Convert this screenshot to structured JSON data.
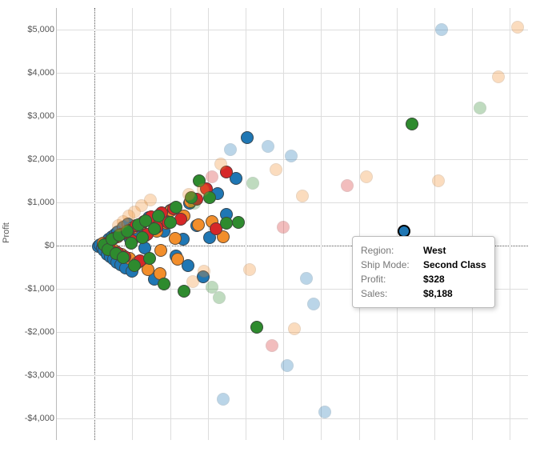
{
  "chart_data": {
    "type": "scatter",
    "ylabel": "Profit",
    "xlabel": "",
    "ylim": [
      -4500,
      5500
    ],
    "xlim": [
      -1000,
      11500
    ],
    "yticks": [
      {
        "v": 5000,
        "label": "$5,000"
      },
      {
        "v": 4000,
        "label": "$4,000"
      },
      {
        "v": 3000,
        "label": "$3,000"
      },
      {
        "v": 2000,
        "label": "$2,000"
      },
      {
        "v": 1000,
        "label": "$1,000"
      },
      {
        "v": 0,
        "label": "$0"
      },
      {
        "v": -1000,
        "label": "-$1,000"
      },
      {
        "v": -2000,
        "label": "-$2,000"
      },
      {
        "v": -3000,
        "label": "-$3,000"
      },
      {
        "v": -4000,
        "label": "-$4,000"
      }
    ],
    "x_gridlines": [
      0,
      1000,
      2000,
      3000,
      4000,
      5000,
      6000,
      7000,
      8000,
      9000,
      10000,
      11000
    ],
    "series_colors": {
      "Central": "#2e8b2e",
      "East": "#f28e2b",
      "South": "#d62728",
      "West": "#1f77b4"
    },
    "points": [
      {
        "sales": 8188,
        "profit": 328,
        "region": "West",
        "ship_mode": "Second Class",
        "highlight": true
      },
      {
        "sales": 100,
        "profit": -20,
        "region": "West",
        "faded": false
      },
      {
        "sales": 150,
        "profit": 10,
        "region": "West",
        "faded": false
      },
      {
        "sales": 200,
        "profit": -60,
        "region": "West",
        "faded": false
      },
      {
        "sales": 220,
        "profit": 40,
        "region": "West",
        "faded": false
      },
      {
        "sales": 260,
        "profit": -120,
        "region": "West",
        "faded": false
      },
      {
        "sales": 300,
        "profit": 80,
        "region": "West",
        "faded": false
      },
      {
        "sales": 340,
        "profit": -200,
        "region": "West",
        "faded": false
      },
      {
        "sales": 380,
        "profit": 140,
        "region": "West",
        "faded": false
      },
      {
        "sales": 420,
        "profit": -260,
        "region": "West",
        "faded": false
      },
      {
        "sales": 460,
        "profit": 200,
        "region": "West",
        "faded": false
      },
      {
        "sales": 500,
        "profit": -320,
        "region": "West",
        "faded": false
      },
      {
        "sales": 540,
        "profit": 260,
        "region": "West",
        "faded": false
      },
      {
        "sales": 580,
        "profit": -380,
        "region": "West",
        "faded": false
      },
      {
        "sales": 620,
        "profit": 320,
        "region": "West",
        "faded": false
      },
      {
        "sales": 700,
        "profit": -440,
        "region": "West",
        "faded": false
      },
      {
        "sales": 760,
        "profit": 420,
        "region": "West",
        "faded": false
      },
      {
        "sales": 820,
        "profit": -520,
        "region": "West",
        "faded": false
      },
      {
        "sales": 880,
        "profit": 500,
        "region": "West",
        "faded": false
      },
      {
        "sales": 940,
        "profit": 140,
        "region": "West",
        "faded": false
      },
      {
        "sales": 1000,
        "profit": -600,
        "region": "West",
        "faded": false
      },
      {
        "sales": 1060,
        "profit": 280,
        "region": "West",
        "faded": false
      },
      {
        "sales": 1140,
        "profit": -380,
        "region": "West",
        "faded": false
      },
      {
        "sales": 1220,
        "profit": 460,
        "region": "West",
        "faded": false
      },
      {
        "sales": 1320,
        "profit": -60,
        "region": "West",
        "faded": false
      },
      {
        "sales": 1440,
        "profit": 640,
        "region": "West",
        "faded": false
      },
      {
        "sales": 1580,
        "profit": -780,
        "region": "West",
        "faded": false
      },
      {
        "sales": 1720,
        "profit": 700,
        "region": "West",
        "faded": false
      },
      {
        "sales": 1840,
        "profit": 340,
        "region": "West",
        "faded": false
      },
      {
        "sales": 2000,
        "profit": 820,
        "region": "West",
        "faded": false
      },
      {
        "sales": 2160,
        "profit": -240,
        "region": "West",
        "faded": false
      },
      {
        "sales": 2340,
        "profit": 140,
        "region": "West",
        "faded": false
      },
      {
        "sales": 2520,
        "profit": 980,
        "region": "West",
        "faded": false
      },
      {
        "sales": 2700,
        "profit": 460,
        "region": "West",
        "faded": false
      },
      {
        "sales": 2480,
        "profit": -460,
        "region": "West",
        "faded": false
      },
      {
        "sales": 3040,
        "profit": 180,
        "region": "West",
        "faded": false
      },
      {
        "sales": 3260,
        "profit": 1200,
        "region": "West",
        "faded": false
      },
      {
        "sales": 3500,
        "profit": 720,
        "region": "West",
        "faded": false
      },
      {
        "sales": 3740,
        "profit": 1560,
        "region": "West",
        "faded": false
      },
      {
        "sales": 4040,
        "profit": 2500,
        "region": "West",
        "faded": false
      },
      {
        "sales": 2880,
        "profit": -720,
        "region": "West",
        "faded": false
      },
      {
        "sales": 220,
        "profit": 60,
        "region": "East",
        "faded": false
      },
      {
        "sales": 320,
        "profit": -40,
        "region": "East",
        "faded": false
      },
      {
        "sales": 420,
        "profit": 120,
        "region": "East",
        "faded": false
      },
      {
        "sales": 520,
        "profit": -120,
        "region": "East",
        "faded": false
      },
      {
        "sales": 620,
        "profit": 200,
        "region": "East",
        "faded": false
      },
      {
        "sales": 720,
        "profit": -200,
        "region": "East",
        "faded": false
      },
      {
        "sales": 820,
        "profit": 300,
        "region": "East",
        "faded": false
      },
      {
        "sales": 920,
        "profit": -300,
        "region": "East",
        "faded": false
      },
      {
        "sales": 1020,
        "profit": 400,
        "region": "East",
        "faded": false
      },
      {
        "sales": 1120,
        "profit": -400,
        "region": "East",
        "faded": false
      },
      {
        "sales": 1220,
        "profit": 500,
        "region": "East",
        "faded": false
      },
      {
        "sales": 1320,
        "profit": 220,
        "region": "East",
        "faded": false
      },
      {
        "sales": 1420,
        "profit": -560,
        "region": "East",
        "faded": false
      },
      {
        "sales": 1520,
        "profit": 620,
        "region": "East",
        "faded": false
      },
      {
        "sales": 1640,
        "profit": 340,
        "region": "East",
        "faded": false
      },
      {
        "sales": 1760,
        "profit": -120,
        "region": "East",
        "faded": false
      },
      {
        "sales": 1900,
        "profit": 520,
        "region": "East",
        "faded": false
      },
      {
        "sales": 2040,
        "profit": 820,
        "region": "East",
        "faded": false
      },
      {
        "sales": 2200,
        "profit": -320,
        "region": "East",
        "faded": false
      },
      {
        "sales": 2360,
        "profit": 680,
        "region": "East",
        "faded": false
      },
      {
        "sales": 2540,
        "profit": 1020,
        "region": "East",
        "faded": false
      },
      {
        "sales": 2740,
        "profit": 480,
        "region": "East",
        "faded": false
      },
      {
        "sales": 2140,
        "profit": 160,
        "region": "East",
        "faded": false
      },
      {
        "sales": 3100,
        "profit": 560,
        "region": "East",
        "faded": false
      },
      {
        "sales": 1740,
        "profit": -640,
        "region": "East",
        "faded": false
      },
      {
        "sales": 3400,
        "profit": 200,
        "region": "East",
        "faded": false
      },
      {
        "sales": 300,
        "profit": 40,
        "region": "South",
        "faded": false
      },
      {
        "sales": 400,
        "profit": -80,
        "region": "South",
        "faded": false
      },
      {
        "sales": 500,
        "profit": 160,
        "region": "South",
        "faded": false
      },
      {
        "sales": 600,
        "profit": -160,
        "region": "South",
        "faded": false
      },
      {
        "sales": 700,
        "profit": 260,
        "region": "South",
        "faded": false
      },
      {
        "sales": 800,
        "profit": -260,
        "region": "South",
        "faded": false
      },
      {
        "sales": 900,
        "profit": 360,
        "region": "South",
        "faded": false
      },
      {
        "sales": 1000,
        "profit": 120,
        "region": "South",
        "faded": false
      },
      {
        "sales": 1100,
        "profit": 460,
        "region": "South",
        "faded": false
      },
      {
        "sales": 1200,
        "profit": -360,
        "region": "South",
        "faded": false
      },
      {
        "sales": 1300,
        "profit": 560,
        "region": "South",
        "faded": false
      },
      {
        "sales": 1400,
        "profit": 260,
        "region": "South",
        "faded": false
      },
      {
        "sales": 1500,
        "profit": 660,
        "region": "South",
        "faded": false
      },
      {
        "sales": 1640,
        "profit": 420,
        "region": "South",
        "faded": false
      },
      {
        "sales": 1780,
        "profit": 760,
        "region": "South",
        "faded": false
      },
      {
        "sales": 1940,
        "profit": 540,
        "region": "South",
        "faded": false
      },
      {
        "sales": 2100,
        "profit": 860,
        "region": "South",
        "faded": false
      },
      {
        "sales": 2280,
        "profit": 620,
        "region": "South",
        "faded": false
      },
      {
        "sales": 2700,
        "profit": 1080,
        "region": "South",
        "faded": false
      },
      {
        "sales": 2960,
        "profit": 1320,
        "region": "South",
        "faded": false
      },
      {
        "sales": 3500,
        "profit": 1700,
        "region": "South",
        "faded": false
      },
      {
        "sales": 3220,
        "profit": 380,
        "region": "South",
        "faded": false
      },
      {
        "sales": 260,
        "profit": 20,
        "region": "Central",
        "faded": false
      },
      {
        "sales": 360,
        "profit": -100,
        "region": "Central",
        "faded": false
      },
      {
        "sales": 460,
        "profit": 140,
        "region": "Central",
        "faded": false
      },
      {
        "sales": 560,
        "profit": -180,
        "region": "Central",
        "faded": false
      },
      {
        "sales": 660,
        "profit": 240,
        "region": "Central",
        "faded": false
      },
      {
        "sales": 760,
        "profit": -280,
        "region": "Central",
        "faded": false
      },
      {
        "sales": 860,
        "profit": 340,
        "region": "Central",
        "faded": false
      },
      {
        "sales": 960,
        "profit": 60,
        "region": "Central",
        "faded": false
      },
      {
        "sales": 1060,
        "profit": -460,
        "region": "Central",
        "faded": false
      },
      {
        "sales": 1160,
        "profit": 480,
        "region": "Central",
        "faded": false
      },
      {
        "sales": 1260,
        "profit": 180,
        "region": "Central",
        "faded": false
      },
      {
        "sales": 1360,
        "profit": 580,
        "region": "Central",
        "faded": false
      },
      {
        "sales": 1460,
        "profit": -300,
        "region": "Central",
        "faded": false
      },
      {
        "sales": 1580,
        "profit": 380,
        "region": "Central",
        "faded": false
      },
      {
        "sales": 1700,
        "profit": 680,
        "region": "Central",
        "faded": false
      },
      {
        "sales": 1840,
        "profit": -880,
        "region": "Central",
        "faded": false
      },
      {
        "sales": 2000,
        "profit": 540,
        "region": "Central",
        "faded": false
      },
      {
        "sales": 2160,
        "profit": 880,
        "region": "Central",
        "faded": false
      },
      {
        "sales": 2360,
        "profit": -1060,
        "region": "Central",
        "faded": false
      },
      {
        "sales": 2560,
        "profit": 1120,
        "region": "Central",
        "faded": false
      },
      {
        "sales": 2780,
        "profit": 1500,
        "region": "Central",
        "faded": false
      },
      {
        "sales": 3040,
        "profit": 1120,
        "region": "Central",
        "faded": false
      },
      {
        "sales": 3800,
        "profit": 540,
        "region": "Central",
        "faded": false
      },
      {
        "sales": 3500,
        "profit": 520,
        "region": "Central",
        "faded": false
      },
      {
        "sales": 4300,
        "profit": -1880,
        "region": "Central",
        "faded": false
      },
      {
        "sales": 8400,
        "profit": 2820,
        "region": "Central",
        "faded": false
      },
      {
        "sales": 9200,
        "profit": 5000,
        "region": "West",
        "faded": true
      },
      {
        "sales": 11200,
        "profit": 5050,
        "region": "East",
        "faded": true
      },
      {
        "sales": 10700,
        "profit": 3900,
        "region": "East",
        "faded": true
      },
      {
        "sales": 10200,
        "profit": 3180,
        "region": "Central",
        "faded": true
      },
      {
        "sales": 9100,
        "profit": 1500,
        "region": "East",
        "faded": true
      },
      {
        "sales": 7200,
        "profit": 1600,
        "region": "East",
        "faded": true
      },
      {
        "sales": 6700,
        "profit": 1380,
        "region": "South",
        "faded": true
      },
      {
        "sales": 5500,
        "profit": 1140,
        "region": "East",
        "faded": true
      },
      {
        "sales": 5000,
        "profit": 420,
        "region": "South",
        "faded": true
      },
      {
        "sales": 4800,
        "profit": 1760,
        "region": "East",
        "faded": true
      },
      {
        "sales": 5200,
        "profit": 2080,
        "region": "West",
        "faded": true
      },
      {
        "sales": 4600,
        "profit": 2300,
        "region": "West",
        "faded": true
      },
      {
        "sales": 4200,
        "profit": 1440,
        "region": "Central",
        "faded": true
      },
      {
        "sales": 3600,
        "profit": 2220,
        "region": "West",
        "faded": true
      },
      {
        "sales": 3340,
        "profit": 1880,
        "region": "East",
        "faded": true
      },
      {
        "sales": 3120,
        "profit": 1600,
        "region": "South",
        "faded": true
      },
      {
        "sales": 2880,
        "profit": 1300,
        "region": "East",
        "faded": true
      },
      {
        "sales": 2640,
        "profit": 980,
        "region": "Central",
        "faded": true
      },
      {
        "sales": 2500,
        "profit": 1180,
        "region": "East",
        "faded": true
      },
      {
        "sales": 1480,
        "profit": 1060,
        "region": "East",
        "faded": true
      },
      {
        "sales": 1240,
        "profit": 920,
        "region": "East",
        "faded": true
      },
      {
        "sales": 1060,
        "profit": 780,
        "region": "East",
        "faded": true
      },
      {
        "sales": 900,
        "profit": 680,
        "region": "East",
        "faded": true
      },
      {
        "sales": 760,
        "profit": 560,
        "region": "East",
        "faded": true
      },
      {
        "sales": 640,
        "profit": 460,
        "region": "East",
        "faded": true
      },
      {
        "sales": 5600,
        "profit": -760,
        "region": "West",
        "faded": true
      },
      {
        "sales": 5800,
        "profit": -1360,
        "region": "West",
        "faded": true
      },
      {
        "sales": 5300,
        "profit": -1920,
        "region": "East",
        "faded": true
      },
      {
        "sales": 4700,
        "profit": -2320,
        "region": "South",
        "faded": true
      },
      {
        "sales": 5100,
        "profit": -2780,
        "region": "West",
        "faded": true
      },
      {
        "sales": 3400,
        "profit": -3560,
        "region": "West",
        "faded": true
      },
      {
        "sales": 6100,
        "profit": -3860,
        "region": "West",
        "faded": true
      },
      {
        "sales": 3100,
        "profit": -960,
        "region": "Central",
        "faded": true
      },
      {
        "sales": 3300,
        "profit": -1200,
        "region": "Central",
        "faded": true
      },
      {
        "sales": 2600,
        "profit": -840,
        "region": "East",
        "faded": true
      },
      {
        "sales": 2900,
        "profit": -600,
        "region": "East",
        "faded": true
      },
      {
        "sales": 4100,
        "profit": -560,
        "region": "East",
        "faded": true
      }
    ]
  },
  "tooltip": {
    "keys": {
      "region": "Region:",
      "ship_mode": "Ship Mode:",
      "profit": "Profit:",
      "sales": "Sales:"
    },
    "values": {
      "region": "West",
      "ship_mode": "Second Class",
      "profit": "$328",
      "sales": "$8,188"
    },
    "pos": {
      "left": 440,
      "top": 295
    }
  }
}
